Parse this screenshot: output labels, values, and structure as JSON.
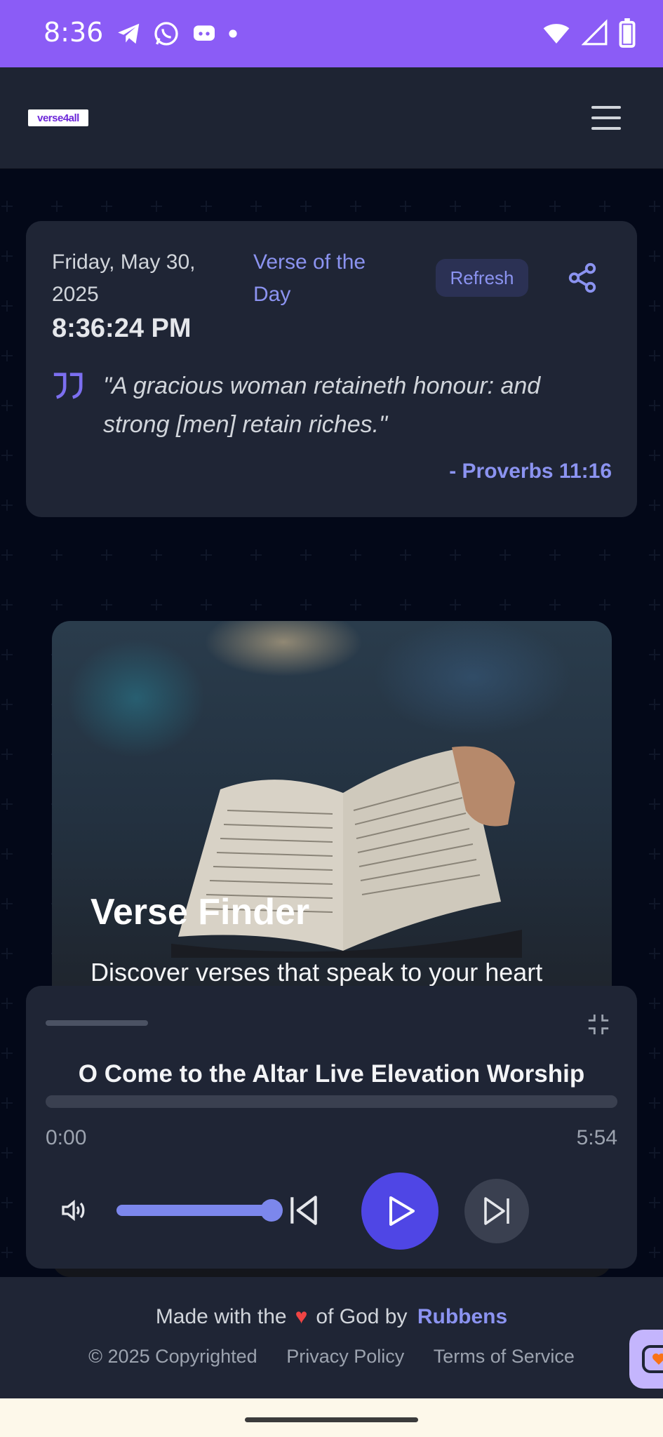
{
  "status_bar": {
    "time": "8:36",
    "icons_left": [
      "telegram-icon",
      "whatsapp-icon",
      "discord-icon",
      "dot-icon"
    ],
    "icons_right": [
      "wifi-icon",
      "signal-icon",
      "battery-icon"
    ]
  },
  "header": {
    "logo_text": "verse4all",
    "menu_icon": "hamburger-icon"
  },
  "verse_card": {
    "date": "Friday, May 30, 2025",
    "clock": "8:36:24 PM",
    "heading": "Verse of the Day",
    "refresh_label": "Refresh",
    "quote": "\"A gracious woman retaineth honour: and strong [men] retain riches.\"",
    "reference": "- Proverbs 11:16"
  },
  "feature_card": {
    "title": "Verse Finder",
    "subtitle": "Discover verses that speak to your heart"
  },
  "player": {
    "track_title": "O Come to the Altar Live Elevation Worship",
    "time_start": "0:00",
    "time_end": "5:54",
    "progress": 0,
    "volume": 1.0
  },
  "footer": {
    "made_prefix": "Made with the",
    "made_suffix": "of God by",
    "author": "Rubbens",
    "copyright": "© 2025 Copyrighted",
    "privacy": "Privacy Policy",
    "terms": "Terms of Service"
  },
  "colors": {
    "status_bar": "#8b5cf6",
    "accent": "#8b93f0",
    "play_button": "#4f46e5",
    "card": "#1f2535",
    "background": "#030818"
  }
}
